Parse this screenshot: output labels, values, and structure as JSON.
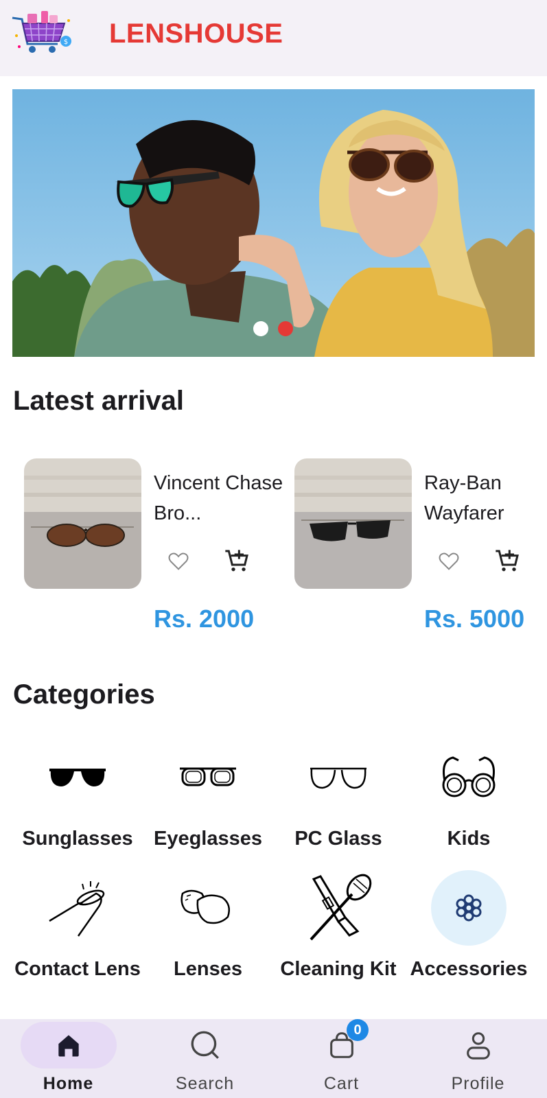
{
  "app": {
    "brand": "LENSHOUSE",
    "logo_icon": "shopping-cart-logo-icon",
    "brand_color": "#e53935"
  },
  "banner": {
    "image": "couple-wearing-sunglasses-photo",
    "slides": 2,
    "active_slide": 2
  },
  "latest_arrival": {
    "title": "Latest arrival",
    "products": [
      {
        "name": "Vincent Chase Bro...",
        "price": "Rs. 2000",
        "image": "round-brown-sunglasses-photo"
      },
      {
        "name": "Ray-Ban Wayfarer",
        "price": "Rs. 5000",
        "image": "black-wayfarer-sunglasses-photo"
      }
    ],
    "price_color": "#2f95e0"
  },
  "categories": {
    "title": "Categories",
    "items": [
      {
        "label": "Sunglasses",
        "icon": "sunglasses-icon"
      },
      {
        "label": "Eyeglasses",
        "icon": "eyeglasses-icon"
      },
      {
        "label": "PC Glass",
        "icon": "pc-glass-icon"
      },
      {
        "label": "Kids",
        "icon": "kids-glasses-icon"
      },
      {
        "label": "Contact Lens",
        "icon": "contact-lens-icon"
      },
      {
        "label": "Lenses",
        "icon": "lenses-icon"
      },
      {
        "label": "Cleaning Kit",
        "icon": "cleaning-kit-icon"
      },
      {
        "label": "Accessories",
        "icon": "accessories-icon"
      }
    ]
  },
  "bottom_nav": {
    "items": [
      {
        "label": "Home",
        "icon": "home-icon",
        "active": true
      },
      {
        "label": "Search",
        "icon": "search-icon",
        "active": false
      },
      {
        "label": "Cart",
        "icon": "cart-bag-icon",
        "active": false,
        "badge": "0"
      },
      {
        "label": "Profile",
        "icon": "profile-icon",
        "active": false
      }
    ]
  }
}
